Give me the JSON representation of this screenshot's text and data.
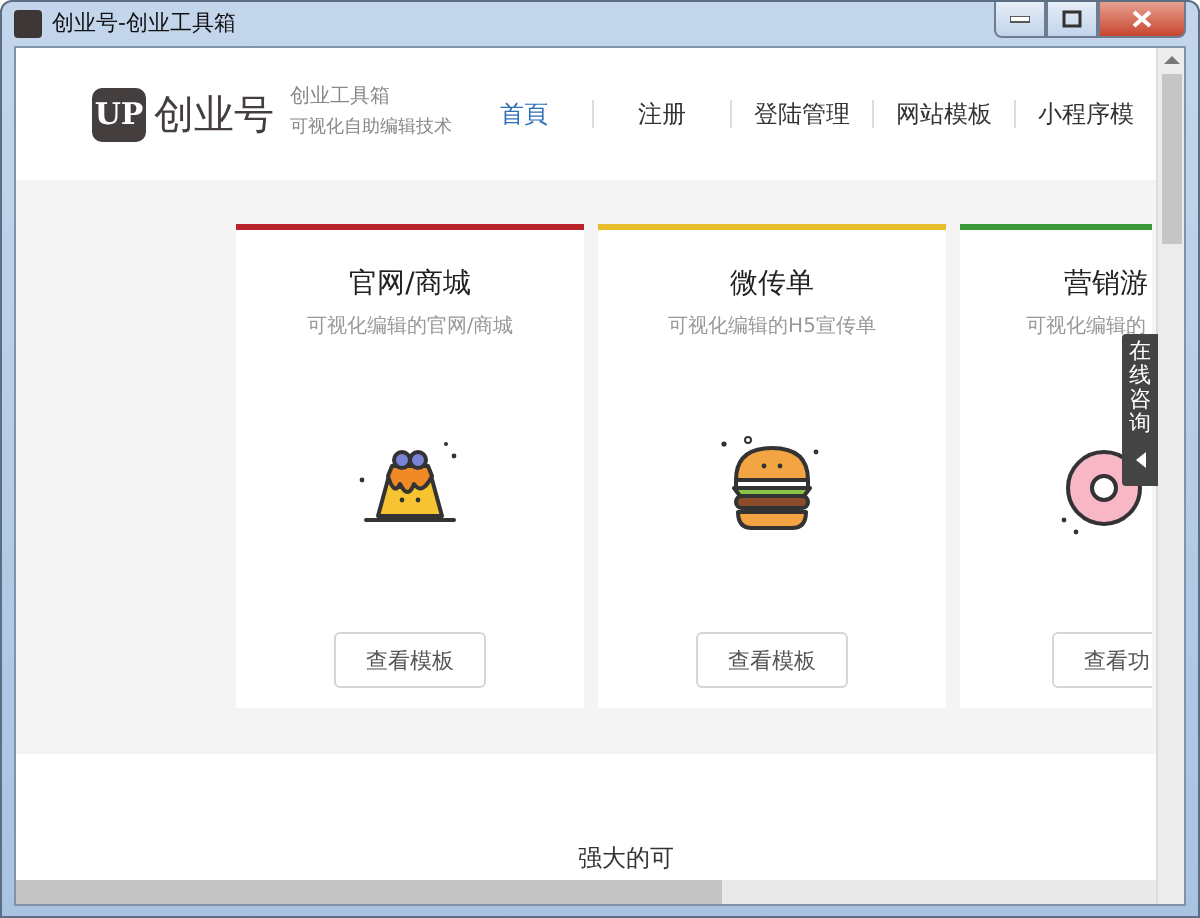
{
  "window": {
    "title": "创业号-创业工具箱"
  },
  "header": {
    "logo_mark": "UP",
    "brand": "创业号",
    "tagline": "创业工具箱",
    "slogan": "可视化自助编辑技术"
  },
  "nav": [
    {
      "label": "首頁",
      "selected": true
    },
    {
      "label": "注册",
      "selected": false
    },
    {
      "label": "登陆管理",
      "selected": false
    },
    {
      "label": "网站模板",
      "selected": false
    },
    {
      "label": "小程序模",
      "selected": false
    }
  ],
  "cards": [
    {
      "title": "官网/商城",
      "subtitle": "可视化编辑的官网/商城",
      "button": "查看模板",
      "color": "#b8232a",
      "kind": "pudding",
      "clipped": false
    },
    {
      "title": "微传单",
      "subtitle": "可视化编辑的H5宣传单",
      "button": "查看模板",
      "color": "#e6bd2c",
      "kind": "burger",
      "clipped": false
    },
    {
      "title": "营销游",
      "subtitle": "可视化编辑的",
      "button": "查看功",
      "color": "#3a9a3a",
      "kind": "donut",
      "clipped": true
    }
  ],
  "side_tab": {
    "label": "在线咨询"
  },
  "footer_text": "强大的可"
}
